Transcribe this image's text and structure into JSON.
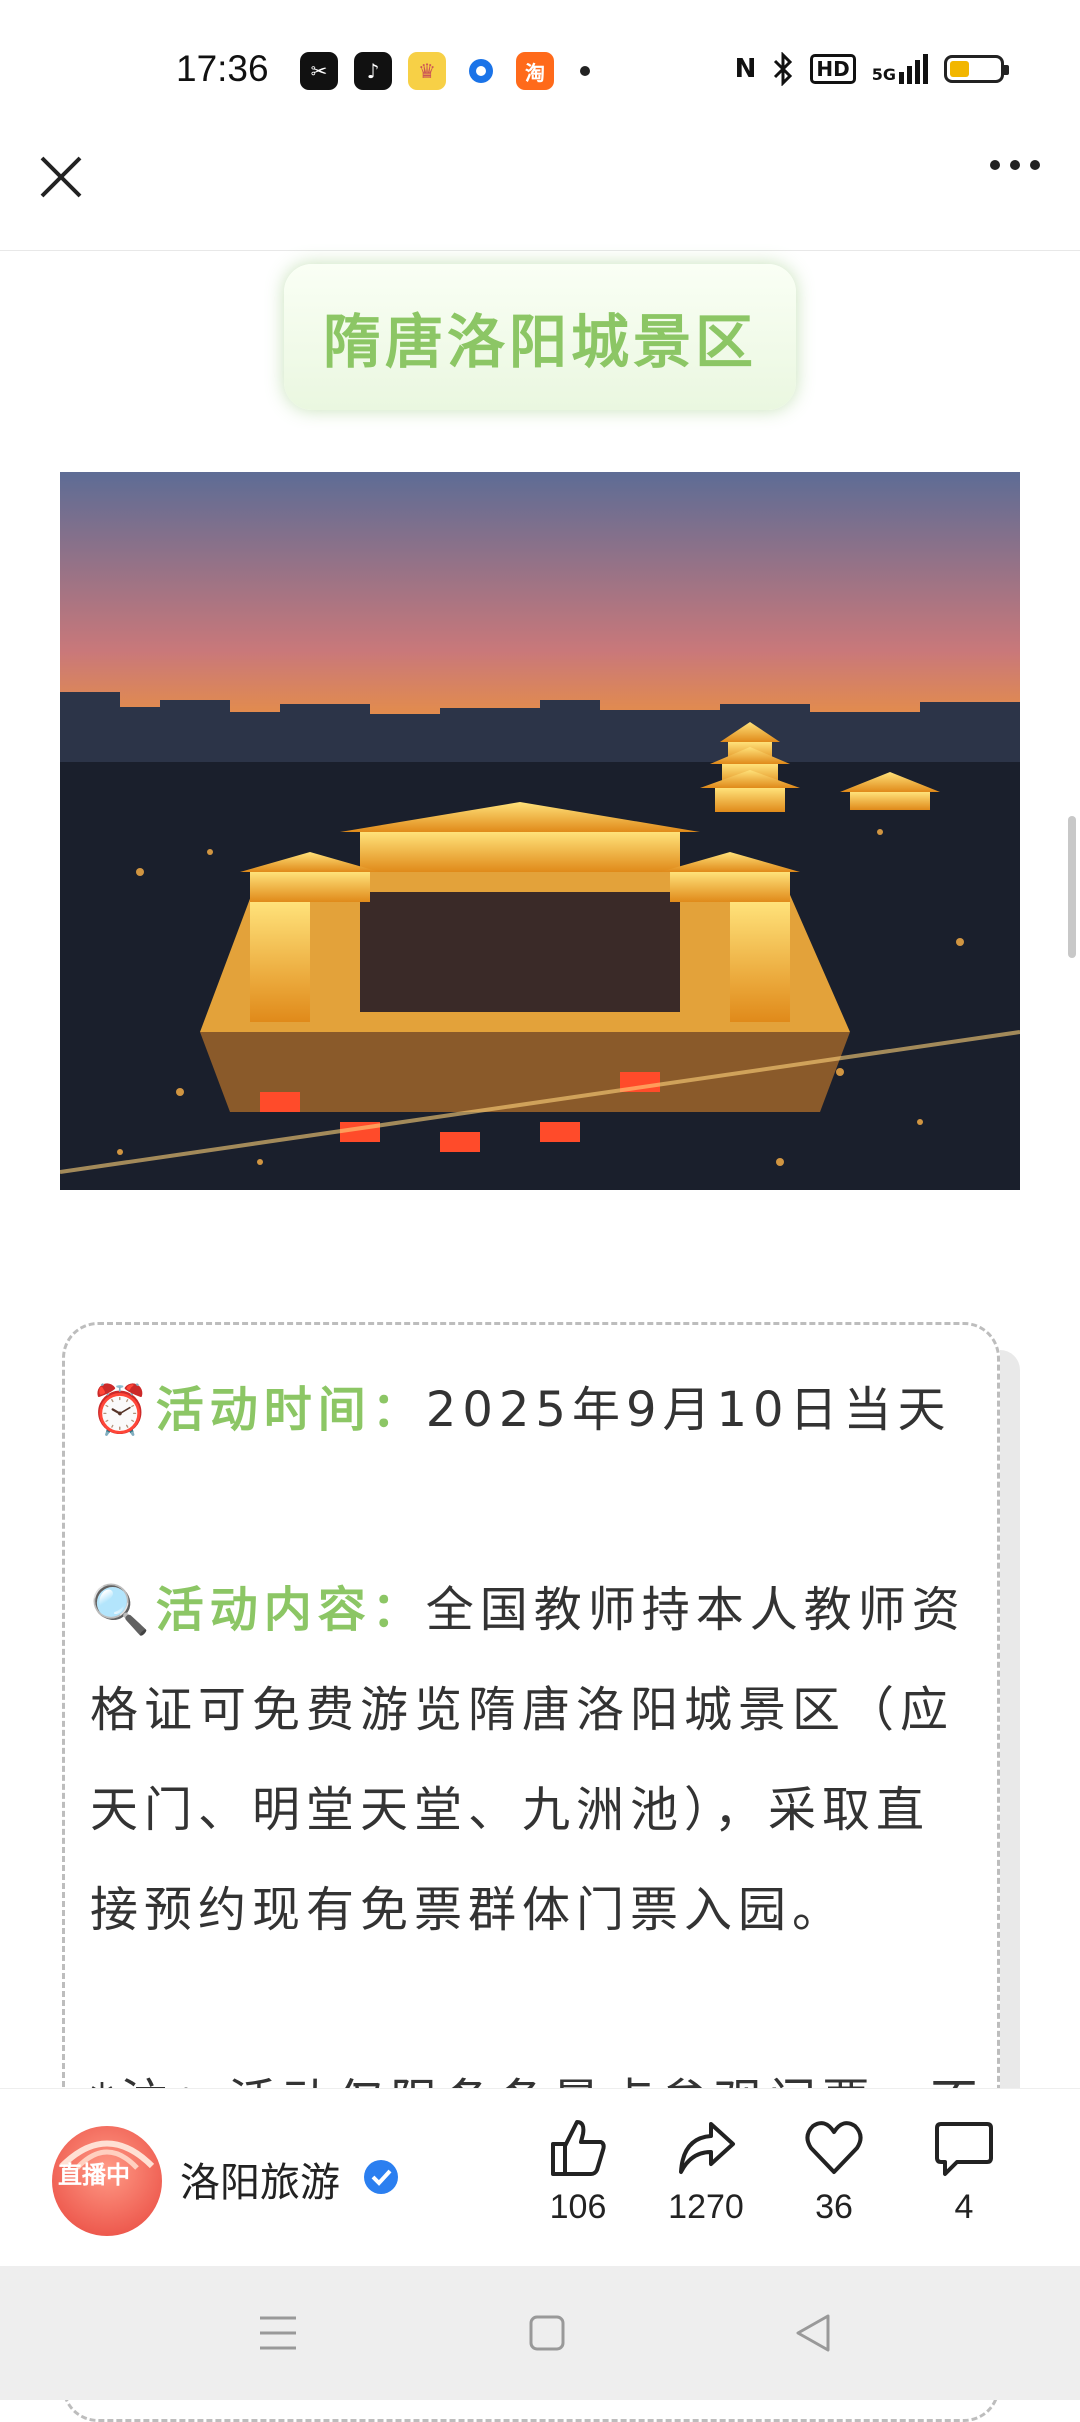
{
  "status_bar": {
    "time": "17:36",
    "apps": [
      "capcut-icon",
      "tiktok-icon",
      "game-icon",
      "browser-icon",
      "taobao-icon"
    ],
    "taobao_glyph": "淘",
    "indicators": {
      "nfc": "N",
      "hd": "HD",
      "network": "5G"
    },
    "battery_level": 0.4
  },
  "article": {
    "title": "隋唐洛阳城景区",
    "activity_time_label": "活动时间：",
    "activity_time_value": "2025年9月10日当天",
    "activity_content_label": "活动内容：",
    "content_lines": [
      "全国教师持本人教师资",
      "格证可免费游览隋唐洛阳城景区（应",
      "天门、明堂天堂、九洲池），采取直",
      "接预约现有免票群体门票入园。"
    ],
    "note_partial": "*注：活动仅限条条景点参观门票，不"
  },
  "bottom_bar": {
    "live_badge": "直播中",
    "author": "洛阳旅游",
    "likes": "106",
    "shares": "1270",
    "favorites": "36",
    "comments": "4"
  },
  "colors": {
    "accent_green": "#8cc665",
    "battery": "#f2b600"
  }
}
